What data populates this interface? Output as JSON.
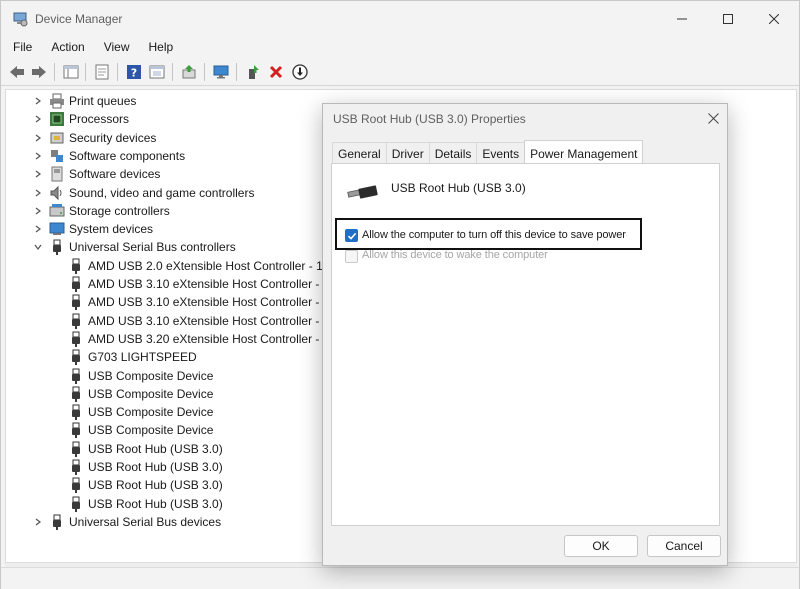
{
  "window": {
    "title": "Device Manager"
  },
  "menu": [
    "File",
    "Action",
    "View",
    "Help"
  ],
  "toolbar_icons": [
    "back-icon",
    "forward-icon",
    "show-hide-tree-icon",
    "properties-icon",
    "help-icon",
    "view-icon",
    "update-driver-icon",
    "scan-hardware-icon",
    "enable-device-icon",
    "uninstall-device-icon",
    "disable-device-icon"
  ],
  "tree": {
    "categories_top": [
      {
        "label": "Print queues",
        "icon": "printer-icon"
      },
      {
        "label": "Processors",
        "icon": "processor-icon"
      },
      {
        "label": "Security devices",
        "icon": "security-icon"
      },
      {
        "label": "Software components",
        "icon": "component-icon"
      },
      {
        "label": "Software devices",
        "icon": "software-device-icon"
      },
      {
        "label": "Sound, video and game controllers",
        "icon": "speaker-icon"
      },
      {
        "label": "Storage controllers",
        "icon": "storage-icon"
      },
      {
        "label": "System devices",
        "icon": "system-icon"
      },
      {
        "label": "Universal Serial Bus controllers",
        "icon": "usb-icon"
      }
    ],
    "usb_children": [
      "AMD USB 2.0 eXtensible Host Controller - 1.",
      "AMD USB 3.10 eXtensible Host Controller - 1",
      "AMD USB 3.10 eXtensible Host Controller - 1",
      "AMD USB 3.10 eXtensible Host Controller - 1",
      "AMD USB 3.20 eXtensible Host Controller - 1",
      "G703 LIGHTSPEED",
      "USB Composite Device",
      "USB Composite Device",
      "USB Composite Device",
      "USB Composite Device",
      "USB Root Hub (USB 3.0)",
      "USB Root Hub (USB 3.0)",
      "USB Root Hub (USB 3.0)",
      "USB Root Hub (USB 3.0)"
    ],
    "categories_bottom": [
      {
        "label": "Universal Serial Bus devices",
        "icon": "usb-icon"
      }
    ]
  },
  "dialog": {
    "title": "USB Root Hub (USB 3.0) Properties",
    "tabs": [
      "General",
      "Driver",
      "Details",
      "Events",
      "Power Management"
    ],
    "active_tab": "Power Management",
    "device_name": "USB Root Hub (USB 3.0)",
    "options": [
      {
        "label": "Allow the computer to turn off this device to save power",
        "checked": true,
        "enabled": true
      },
      {
        "label": "Allow this device to wake the computer",
        "checked": false,
        "enabled": false
      }
    ],
    "ok_label": "OK",
    "cancel_label": "Cancel"
  },
  "colors": {
    "accent": "#1f6fc6",
    "highlight_border": "#111111"
  }
}
